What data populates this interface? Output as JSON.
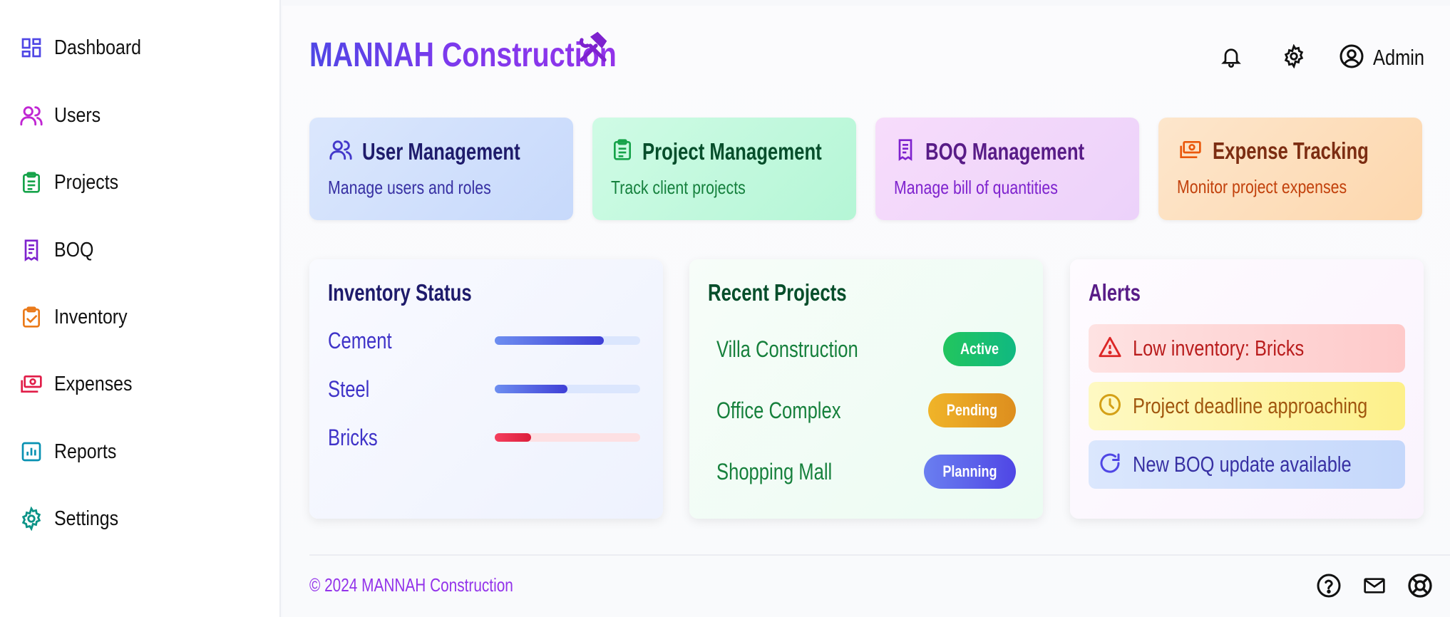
{
  "sidebar": {
    "items": [
      {
        "label": "Dashboard",
        "icon": "dashboard-icon",
        "color": "#4f46e5"
      },
      {
        "label": "Users",
        "icon": "users-icon",
        "color": "#c026d3"
      },
      {
        "label": "Projects",
        "icon": "clipboard-icon",
        "color": "#16a34a"
      },
      {
        "label": "BOQ",
        "icon": "receipt-icon",
        "color": "#7e22ce"
      },
      {
        "label": "Inventory",
        "icon": "clipboard-check-icon",
        "color": "#ea7a1a"
      },
      {
        "label": "Expenses",
        "icon": "cash-icon",
        "color": "#e11d48"
      },
      {
        "label": "Reports",
        "icon": "chart-icon",
        "color": "#0891b2"
      },
      {
        "label": "Settings",
        "icon": "gear-icon",
        "color": "#0d9488"
      }
    ]
  },
  "header": {
    "title": "MANNAH Construction",
    "admin_label": "Admin"
  },
  "cards": [
    {
      "title": "User Management",
      "desc": "Manage users and roles",
      "icon": "users-icon"
    },
    {
      "title": "Project Management",
      "desc": "Track client projects",
      "icon": "clipboard-icon"
    },
    {
      "title": "BOQ Management",
      "desc": "Manage bill of quantities",
      "icon": "receipt-icon"
    },
    {
      "title": "Expense Tracking",
      "desc": "Monitor project expenses",
      "icon": "cash-icon"
    }
  ],
  "inventory": {
    "title": "Inventory Status",
    "items": [
      {
        "name": "Cement",
        "level": 0.75
      },
      {
        "name": "Steel",
        "level": 0.5
      },
      {
        "name": "Bricks",
        "level": 0.25
      }
    ]
  },
  "projects": {
    "title": "Recent Projects",
    "items": [
      {
        "name": "Villa Construction",
        "status": "Active"
      },
      {
        "name": "Office Complex",
        "status": "Pending"
      },
      {
        "name": "Shopping Mall",
        "status": "Planning"
      }
    ]
  },
  "alerts": {
    "title": "Alerts",
    "items": [
      {
        "text": "Low inventory: Bricks",
        "icon": "warning-icon"
      },
      {
        "text": "Project deadline approaching",
        "icon": "clock-icon"
      },
      {
        "text": "New BOQ update available",
        "icon": "refresh-icon"
      }
    ]
  },
  "footer": {
    "copyright": "© 2024 MANNAH Construction"
  }
}
